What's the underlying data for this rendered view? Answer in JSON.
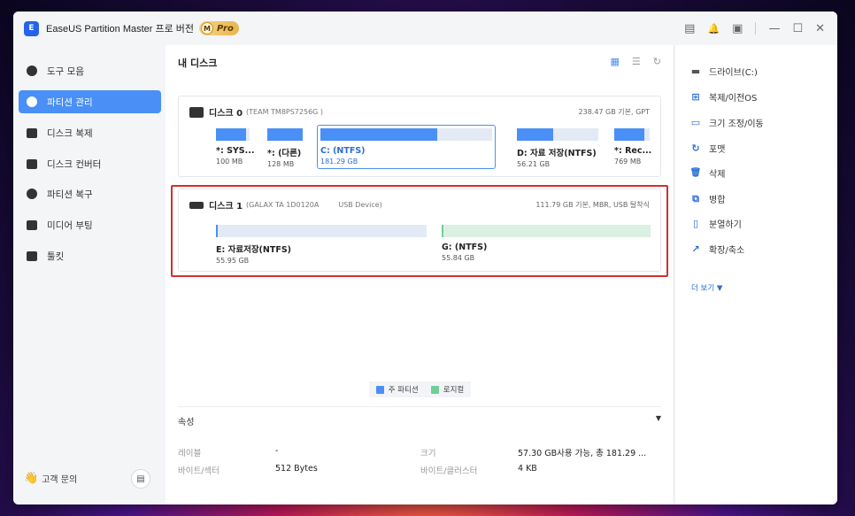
{
  "app": {
    "logo_text": "E",
    "title": "EaseUS Partition Master 프로 버전",
    "badge_letter": "M",
    "badge": "Pro"
  },
  "titlebar": {
    "icons": [
      "feedback-icon",
      "bell-icon",
      "window-icon",
      "minimize-icon",
      "maximize-icon",
      "close-icon"
    ],
    "glyphs": [
      "▤",
      "🔔",
      "▣",
      "—",
      "☐",
      "✕"
    ]
  },
  "sidebar": {
    "items": [
      {
        "label": "도구 모음"
      },
      {
        "label": "파티션 관리"
      },
      {
        "label": "디스크 복제"
      },
      {
        "label": "디스크 컨버터"
      },
      {
        "label": "파티션 복구"
      },
      {
        "label": "미디어 부팅"
      },
      {
        "label": "툴킷"
      }
    ],
    "support": "고객 문의",
    "support_icon": "👋"
  },
  "main": {
    "title": "내 디스크",
    "view_glyphs": [
      "▦",
      "☰",
      "↻"
    ],
    "disks": [
      {
        "name": "디스크 0",
        "model": "(TEAM TM8PS7256G )",
        "info": "238.47 GB 기본, GPT",
        "partitions": [
          {
            "label": "*: SYS...",
            "size": "100 MB",
            "used_pct": 90
          },
          {
            "label": "*: (다른)",
            "size": "128 MB",
            "used_pct": 100
          },
          {
            "label": "C: (NTFS)",
            "size": "181.29 GB",
            "used_pct": 68
          },
          {
            "label": "D: 자료 저장(NTFS)",
            "size": "56.21 GB",
            "used_pct": 45
          },
          {
            "label": "*: Rec...",
            "size": "769 MB",
            "used_pct": 85
          }
        ]
      },
      {
        "name": "디스크 1",
        "model": "(GALAX TA 1D0120A",
        "usb": "USB Device)",
        "info": "111.79 GB 기본, MBR, USB 탈착식",
        "partitions": [
          {
            "label": "E: 자료저장(NTFS)",
            "size": "55.95 GB",
            "used_pct": 1
          },
          {
            "label": "G: (NTFS)",
            "size": "55.84 GB",
            "used_pct": 1
          }
        ]
      }
    ],
    "legend": [
      {
        "label": "주 파티션",
        "color": "#4a8ff5"
      },
      {
        "label": "로지컬",
        "color": "#6fcf97"
      }
    ]
  },
  "properties": {
    "title": "속성",
    "caret": "▼",
    "rows": [
      {
        "key": "레이블",
        "value": "-",
        "key2": "크기",
        "value2": "57.30 GB사용 가능, 총 181.29 ..."
      },
      {
        "key": "바이트/섹터",
        "value": "512 Bytes",
        "key2": "바이트/클러스터",
        "value2": "4 KB"
      }
    ]
  },
  "actions": {
    "items": [
      {
        "label": "드라이브(C:)",
        "icon": "drive-icon"
      },
      {
        "label": "복제/이전OS",
        "icon": "windows-icon"
      },
      {
        "label": "크기 조정/이동",
        "icon": "resize-icon"
      },
      {
        "label": "포맷",
        "icon": "format-icon"
      },
      {
        "label": "삭제",
        "icon": "delete-icon"
      },
      {
        "label": "병합",
        "icon": "merge-icon"
      },
      {
        "label": "분열하기",
        "icon": "split-icon"
      },
      {
        "label": "확장/축소",
        "icon": "extend-icon"
      }
    ],
    "glyphs": [
      "▬",
      "⊞",
      "▭",
      "↻",
      "🗑",
      "⧉",
      "▯",
      "↗"
    ],
    "more": "더 보기 ▼"
  }
}
